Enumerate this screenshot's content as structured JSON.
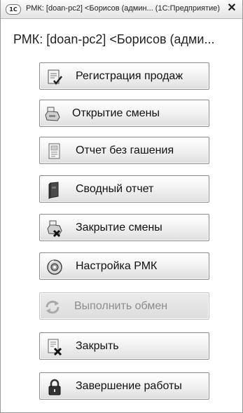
{
  "window": {
    "app_icon": "1С",
    "title": "РМК: [doan-pc2] <Борисов (админ...  (1С:Предприятие)"
  },
  "header": {
    "title": "РМК: [doan-pc2] <Борисов (адми..."
  },
  "buttons": [
    {
      "label": "Регистрация продаж",
      "icon": "sales-receipt-icon",
      "enabled": true
    },
    {
      "label": "Открытие смены",
      "icon": "cash-register-icon",
      "enabled": true
    },
    {
      "label": "Отчет без гашения",
      "icon": "report-document-icon",
      "enabled": true
    },
    {
      "label": "Сводный отчет",
      "icon": "summary-book-icon",
      "enabled": true
    },
    {
      "label": "Закрытие смены",
      "icon": "close-shift-icon",
      "enabled": true
    },
    {
      "label": "Настройка РМК",
      "icon": "settings-disc-icon",
      "enabled": true
    },
    {
      "label": "Выполнить обмен",
      "icon": "exchange-arrows-icon",
      "enabled": false
    },
    {
      "label": "Закрыть",
      "icon": "close-document-icon",
      "enabled": true
    },
    {
      "label": "Завершение работы",
      "icon": "padlock-icon",
      "enabled": true
    }
  ]
}
